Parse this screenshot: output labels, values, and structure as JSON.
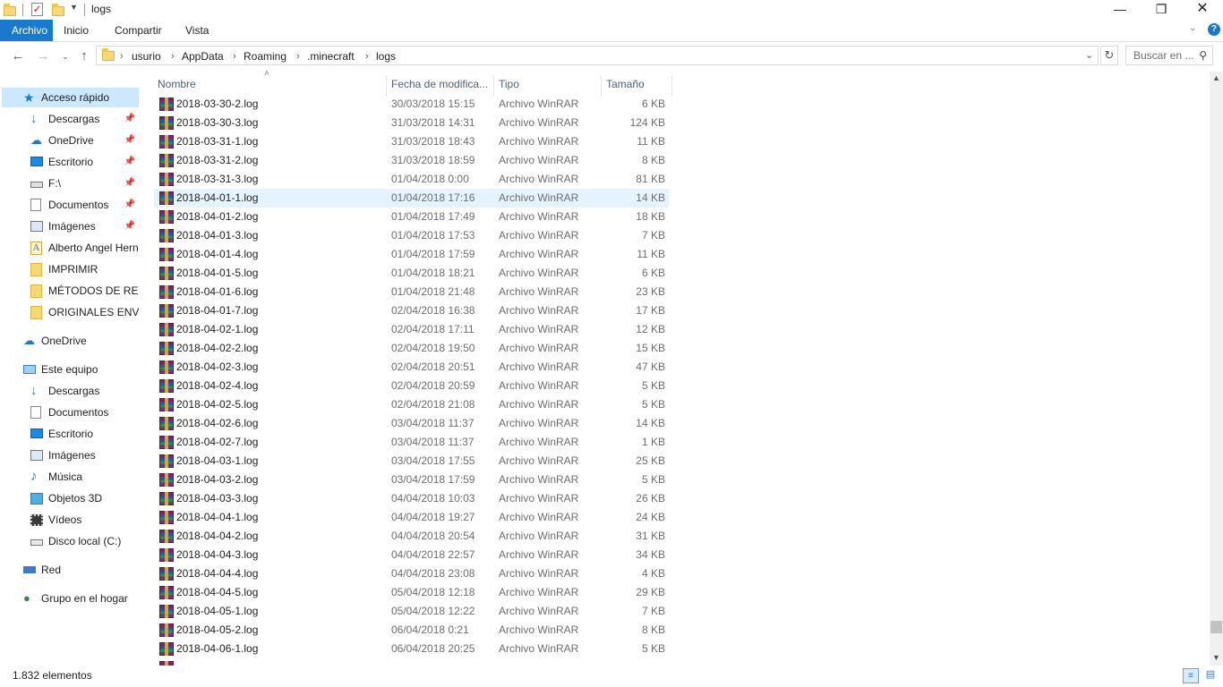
{
  "window": {
    "title": "logs"
  },
  "ribbon": {
    "tabs": [
      "Archivo",
      "Inicio",
      "Compartir",
      "Vista"
    ]
  },
  "address": {
    "crumbs": [
      "usurio",
      "AppData",
      "Roaming",
      ".minecraft",
      "logs"
    ]
  },
  "search": {
    "placeholder": "Buscar en ..."
  },
  "nav": {
    "quick_access": "Acceso rápido",
    "quick_items": [
      {
        "label": "Descargas",
        "icon": "download-icon",
        "pinned": true
      },
      {
        "label": "OneDrive",
        "icon": "cloud-icon",
        "pinned": true
      },
      {
        "label": "Escritorio",
        "icon": "desktop-icon",
        "pinned": true
      },
      {
        "label": "F:\\",
        "icon": "drive-icon",
        "pinned": true
      },
      {
        "label": "Documentos",
        "icon": "documents-icon",
        "pinned": true
      },
      {
        "label": "Imágenes",
        "icon": "pictures-icon",
        "pinned": true
      },
      {
        "label": "Alberto Angel Hern",
        "icon": "font-file-icon",
        "pinned": false
      },
      {
        "label": "IMPRIMIR",
        "icon": "folder-icon",
        "pinned": false
      },
      {
        "label": "MÉTODOS DE RELA",
        "icon": "folder-icon",
        "pinned": false
      },
      {
        "label": "ORIGINALES ENVIA",
        "icon": "folder-icon",
        "pinned": false
      }
    ],
    "onedrive": "OneDrive",
    "this_pc": "Este equipo",
    "pc_items": [
      {
        "label": "Descargas",
        "icon": "download-icon"
      },
      {
        "label": "Documentos",
        "icon": "documents-icon"
      },
      {
        "label": "Escritorio",
        "icon": "desktop-icon"
      },
      {
        "label": "Imágenes",
        "icon": "pictures-icon"
      },
      {
        "label": "Música",
        "icon": "music-icon"
      },
      {
        "label": "Objetos 3D",
        "icon": "3d-objects-icon"
      },
      {
        "label": "Vídeos",
        "icon": "videos-icon"
      },
      {
        "label": "Disco local (C:)",
        "icon": "local-disk-icon"
      }
    ],
    "network": "Red",
    "homegroup": "Grupo en el hogar"
  },
  "columns": {
    "name": "Nombre",
    "date": "Fecha de modifica...",
    "type": "Tipo",
    "size": "Tamaño"
  },
  "files": [
    {
      "name": "2018-03-30-2.log",
      "date": "30/03/2018 15:15",
      "type": "Archivo WinRAR",
      "size": "6 KB"
    },
    {
      "name": "2018-03-30-3.log",
      "date": "31/03/2018 14:31",
      "type": "Archivo WinRAR",
      "size": "124 KB"
    },
    {
      "name": "2018-03-31-1.log",
      "date": "31/03/2018 18:43",
      "type": "Archivo WinRAR",
      "size": "11 KB"
    },
    {
      "name": "2018-03-31-2.log",
      "date": "31/03/2018 18:59",
      "type": "Archivo WinRAR",
      "size": "8 KB"
    },
    {
      "name": "2018-03-31-3.log",
      "date": "01/04/2018 0:00",
      "type": "Archivo WinRAR",
      "size": "81 KB"
    },
    {
      "name": "2018-04-01-1.log",
      "date": "01/04/2018 17:16",
      "type": "Archivo WinRAR",
      "size": "14 KB",
      "selected": true
    },
    {
      "name": "2018-04-01-2.log",
      "date": "01/04/2018 17:49",
      "type": "Archivo WinRAR",
      "size": "18 KB"
    },
    {
      "name": "2018-04-01-3.log",
      "date": "01/04/2018 17:53",
      "type": "Archivo WinRAR",
      "size": "7 KB"
    },
    {
      "name": "2018-04-01-4.log",
      "date": "01/04/2018 17:59",
      "type": "Archivo WinRAR",
      "size": "11 KB"
    },
    {
      "name": "2018-04-01-5.log",
      "date": "01/04/2018 18:21",
      "type": "Archivo WinRAR",
      "size": "6 KB"
    },
    {
      "name": "2018-04-01-6.log",
      "date": "01/04/2018 21:48",
      "type": "Archivo WinRAR",
      "size": "23 KB"
    },
    {
      "name": "2018-04-01-7.log",
      "date": "02/04/2018 16:38",
      "type": "Archivo WinRAR",
      "size": "17 KB"
    },
    {
      "name": "2018-04-02-1.log",
      "date": "02/04/2018 17:11",
      "type": "Archivo WinRAR",
      "size": "12 KB"
    },
    {
      "name": "2018-04-02-2.log",
      "date": "02/04/2018 19:50",
      "type": "Archivo WinRAR",
      "size": "15 KB"
    },
    {
      "name": "2018-04-02-3.log",
      "date": "02/04/2018 20:51",
      "type": "Archivo WinRAR",
      "size": "47 KB"
    },
    {
      "name": "2018-04-02-4.log",
      "date": "02/04/2018 20:59",
      "type": "Archivo WinRAR",
      "size": "5 KB"
    },
    {
      "name": "2018-04-02-5.log",
      "date": "02/04/2018 21:08",
      "type": "Archivo WinRAR",
      "size": "5 KB"
    },
    {
      "name": "2018-04-02-6.log",
      "date": "03/04/2018 11:37",
      "type": "Archivo WinRAR",
      "size": "14 KB"
    },
    {
      "name": "2018-04-02-7.log",
      "date": "03/04/2018 11:37",
      "type": "Archivo WinRAR",
      "size": "1 KB"
    },
    {
      "name": "2018-04-03-1.log",
      "date": "03/04/2018 17:55",
      "type": "Archivo WinRAR",
      "size": "25 KB"
    },
    {
      "name": "2018-04-03-2.log",
      "date": "03/04/2018 17:59",
      "type": "Archivo WinRAR",
      "size": "5 KB"
    },
    {
      "name": "2018-04-03-3.log",
      "date": "04/04/2018 10:03",
      "type": "Archivo WinRAR",
      "size": "26 KB"
    },
    {
      "name": "2018-04-04-1.log",
      "date": "04/04/2018 19:27",
      "type": "Archivo WinRAR",
      "size": "24 KB"
    },
    {
      "name": "2018-04-04-2.log",
      "date": "04/04/2018 20:54",
      "type": "Archivo WinRAR",
      "size": "31 KB"
    },
    {
      "name": "2018-04-04-3.log",
      "date": "04/04/2018 22:57",
      "type": "Archivo WinRAR",
      "size": "34 KB"
    },
    {
      "name": "2018-04-04-4.log",
      "date": "04/04/2018 23:08",
      "type": "Archivo WinRAR",
      "size": "4 KB"
    },
    {
      "name": "2018-04-04-5.log",
      "date": "05/04/2018 12:18",
      "type": "Archivo WinRAR",
      "size": "29 KB"
    },
    {
      "name": "2018-04-05-1.log",
      "date": "05/04/2018 12:22",
      "type": "Archivo WinRAR",
      "size": "7 KB"
    },
    {
      "name": "2018-04-05-2.log",
      "date": "06/04/2018 0:21",
      "type": "Archivo WinRAR",
      "size": "8 KB"
    },
    {
      "name": "2018-04-06-1.log",
      "date": "06/04/2018 20:25",
      "type": "Archivo WinRAR",
      "size": "5 KB"
    }
  ],
  "status": {
    "item_count": "1.832 elementos"
  },
  "colors": {
    "accent": "#1979ca",
    "selection": "#cce8ff",
    "row_selected": "#e5f3ff"
  }
}
